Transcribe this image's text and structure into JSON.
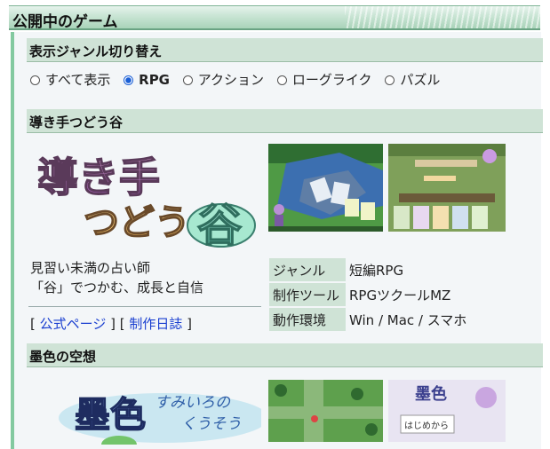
{
  "page": {
    "title": "公開中のゲーム"
  },
  "genre_switch": {
    "heading": "表示ジャンル切り替え",
    "options": [
      {
        "label": "すべて表示",
        "selected": false
      },
      {
        "label": "RPG",
        "selected": true
      },
      {
        "label": "アクション",
        "selected": false
      },
      {
        "label": "ローグライク",
        "selected": false
      },
      {
        "label": "パズル",
        "selected": false
      }
    ]
  },
  "games": [
    {
      "title": "導き手つどう谷",
      "logo_text": {
        "line1": "導き手",
        "line2": "つどう",
        "kanji": "谷"
      },
      "description": [
        "見習い未満の占い師",
        "「谷」でつかむ、成長と自信"
      ],
      "links": {
        "official": "公式ページ",
        "diary": "制作日誌"
      },
      "info": [
        {
          "key": "ジャンル",
          "value": "短編RPG"
        },
        {
          "key": "制作ツール",
          "value": "RPGツクールMZ"
        },
        {
          "key": "動作環境",
          "value": "Win / Mac / スマホ"
        }
      ]
    },
    {
      "title": "墨色の空想",
      "logo_text": {
        "main": "墨色",
        "reading1": "すみいろの",
        "reading2": "くうそう"
      },
      "screenshot_text": {
        "title": "墨色",
        "sub": "はじめから"
      }
    }
  ],
  "colors": {
    "accent": "#83c9a0",
    "section_bg": "#cfe3d6",
    "link": "#1a3fd0",
    "radio_selected": "#1a5fd6"
  }
}
